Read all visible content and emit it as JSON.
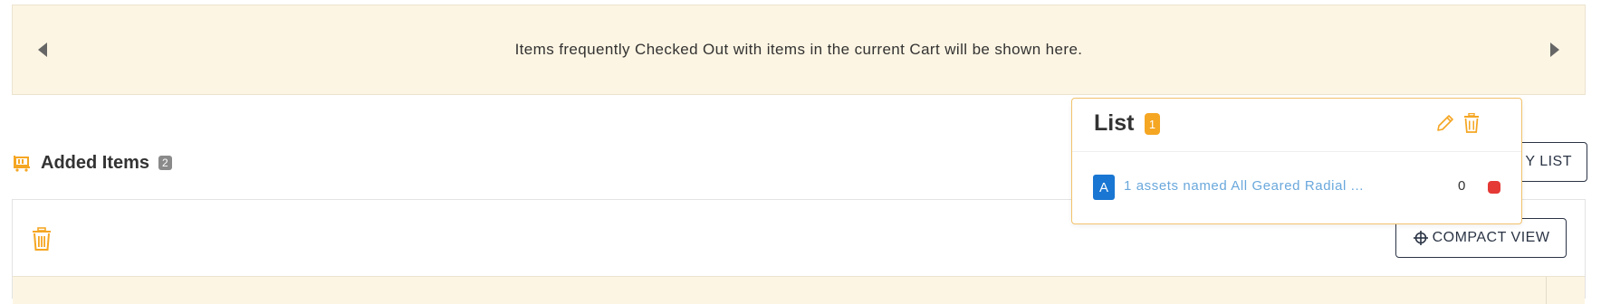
{
  "banner": {
    "message": "Items frequently Checked Out with items in the current Cart will be shown here.",
    "prev_icon": "caret-left-icon",
    "next_icon": "caret-right-icon"
  },
  "added_items": {
    "icon": "cart-icon",
    "title": "Added Items",
    "count": "2",
    "view_list_label": "Y LIST",
    "trash_icon": "trash-icon",
    "compact_view_label": "COMPACT VIEW",
    "compact_icon": "crosshair-icon"
  },
  "list_popup": {
    "title": "List",
    "count": "1",
    "edit_icon": "pencil-icon",
    "delete_icon": "trash-icon",
    "items": [
      {
        "avatar": "A",
        "label": "1 assets named All Geared Radial ...",
        "qty": "0",
        "remove_icon": "remove-dot-icon"
      }
    ]
  },
  "colors": {
    "banner_bg": "#fdf5e3",
    "accent_orange": "#f5a623",
    "link_blue": "#6aa8dc",
    "avatar_blue": "#1976d2",
    "remove_red": "#e53935",
    "button_border": "#2b3445"
  }
}
